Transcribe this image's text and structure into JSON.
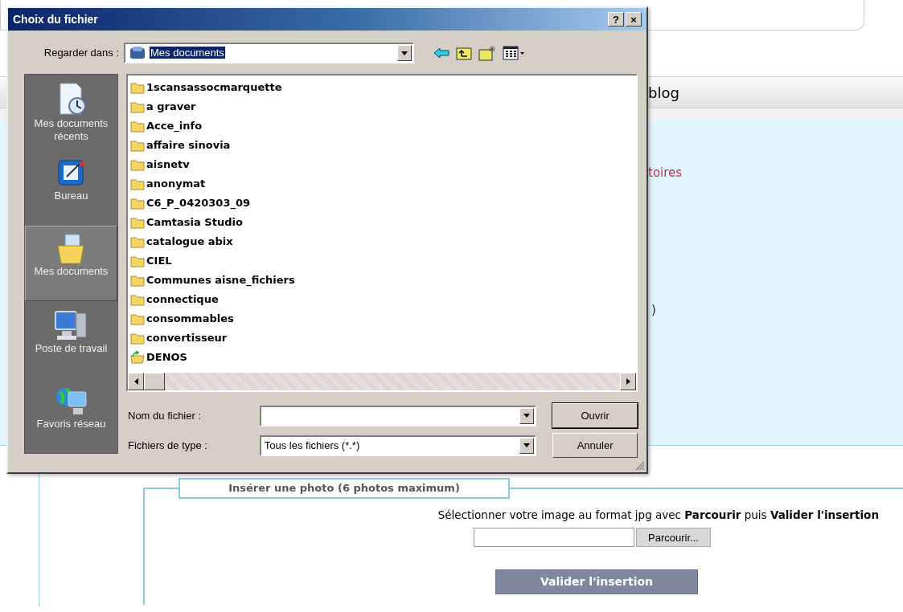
{
  "dialog": {
    "title": "Choix du fichier",
    "title_buttons": [
      "?",
      "×"
    ],
    "look_in": {
      "label": "Regarder dans :",
      "value": "Mes documents"
    },
    "places": [
      {
        "label": "Mes documents récents",
        "kind": "recent",
        "selected": false
      },
      {
        "label": "Bureau",
        "kind": "desktop",
        "selected": false
      },
      {
        "label": "Mes documents",
        "kind": "documents",
        "selected": true
      },
      {
        "label": "Poste de travail",
        "kind": "computer",
        "selected": false
      },
      {
        "label": "Favoris réseau",
        "kind": "network",
        "selected": false
      }
    ],
    "files": [
      {
        "name": "1scansassocmarquette",
        "kind": "folder"
      },
      {
        "name": "a graver",
        "kind": "folder"
      },
      {
        "name": "Acce_info",
        "kind": "folder"
      },
      {
        "name": "affaire sinovia",
        "kind": "folder"
      },
      {
        "name": "aisnetv",
        "kind": "folder"
      },
      {
        "name": "anonymat",
        "kind": "folder"
      },
      {
        "name": "C6_P_0420303_09",
        "kind": "folder"
      },
      {
        "name": "Camtasia Studio",
        "kind": "folder"
      },
      {
        "name": "catalogue abix",
        "kind": "folder"
      },
      {
        "name": "CIEL",
        "kind": "folder"
      },
      {
        "name": "Communes aisne_fichiers",
        "kind": "folder"
      },
      {
        "name": "connectique",
        "kind": "folder"
      },
      {
        "name": "consommables",
        "kind": "folder"
      },
      {
        "name": "convertisseur",
        "kind": "folder"
      },
      {
        "name": "DENOS",
        "kind": "shortcut"
      }
    ],
    "file_name": {
      "label": "Nom du fichier :"
    },
    "file_type": {
      "label": "Fichiers de type :",
      "value": "Tous les fichiers (*.*)"
    },
    "buttons": [
      {
        "label": "Ouvrir",
        "default": true
      },
      {
        "label": "Annuler",
        "default": false
      }
    ]
  },
  "page": {
    "section_title": "blog",
    "link_fragment": "toires",
    "text_fragment": ")",
    "photo_box": {
      "legend": "Insérer une photo (6 photos maximum)",
      "instruction": "Sélectionner votre image au format jpg avec **Parcourir** puis **Valider l'insertion**",
      "browse_button": "Parcourir...",
      "submit_button": "Valider l'insertion"
    }
  }
}
